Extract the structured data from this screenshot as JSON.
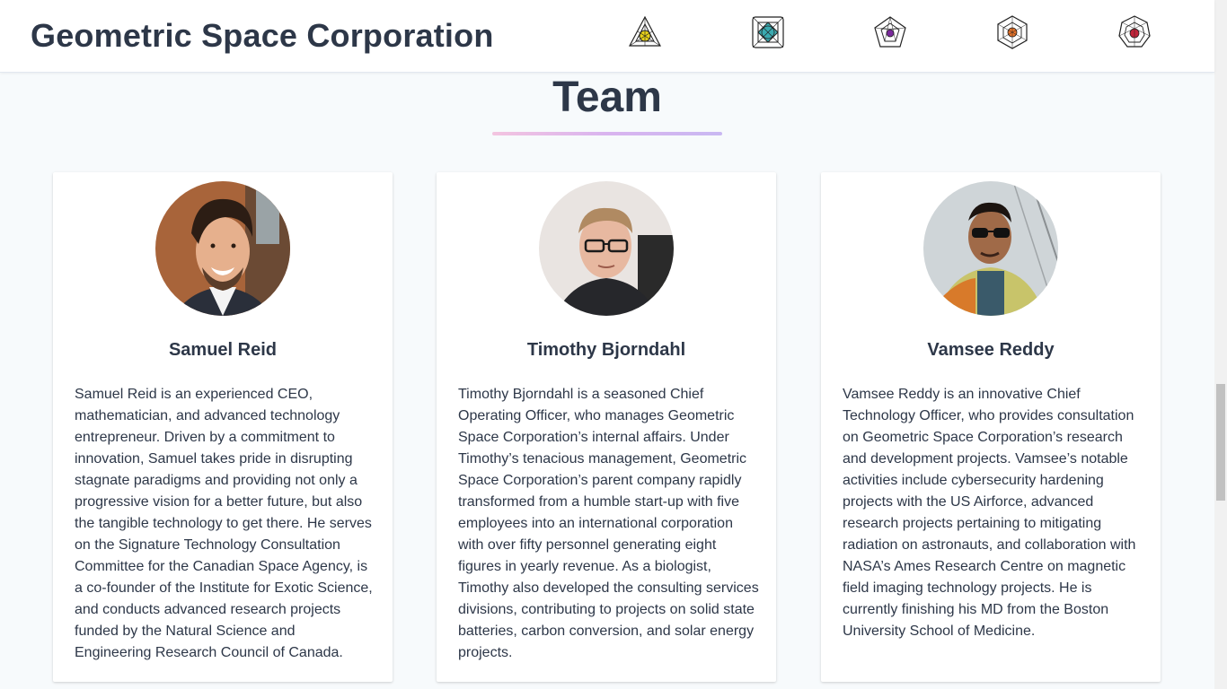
{
  "header": {
    "brand": "Geometric Space Corporation",
    "nav_icons": [
      {
        "name": "triangle-sacred-geometry-icon",
        "accent": "#e8d21a"
      },
      {
        "name": "square-sacred-geometry-icon",
        "accent": "#3aaab0"
      },
      {
        "name": "pentagon-sacred-geometry-icon",
        "accent": "#7a2a9c"
      },
      {
        "name": "hexagon-sacred-geometry-icon",
        "accent": "#e8742a"
      },
      {
        "name": "heptagon-sacred-geometry-icon",
        "accent": "#c0243a"
      }
    ]
  },
  "team": {
    "title": "Team",
    "members": [
      {
        "name": "Samuel Reid",
        "bio": "Samuel Reid is an experienced CEO, mathematician, and advanced technology entrepreneur. Driven by a commitment to innovation, Samuel takes pride in disrupting stagnate paradigms and providing not only a progressive vision for a better future, but also the tangible technology to get there. He serves on the Signature Technology Consultation Committee for the Canadian Space Agency, is a co-founder of the Institute for Exotic Science, and conducts advanced research projects funded by the Natural Science and Engineering Research Council of Canada."
      },
      {
        "name": "Timothy Bjorndahl",
        "bio": "Timothy Bjorndahl is a seasoned Chief Operating Officer, who manages Geometric Space Corporation’s internal affairs. Under Timothy’s tenacious management, Geometric Space Corporation’s parent company rapidly transformed from a humble start-up with five employees into an international corporation with over fifty personnel generating eight figures in yearly revenue. As a biologist, Timothy also developed the consulting services divisions, contributing to projects on solid state batteries, carbon conversion, and solar energy projects."
      },
      {
        "name": "Vamsee Reddy",
        "bio": "Vamsee Reddy is an innovative Chief Technology Officer, who provides consultation on Geometric Space Corporation’s research and development projects. Vamsee’s notable activities include cybersecurity hardening projects with the US Airforce, advanced research projects pertaining to mitigating radiation on astronauts, and collaboration with NASA’s Ames Research Centre on magnetic field imaging technology projects. He is currently finishing his MD from the Boston University School of Medicine."
      }
    ]
  }
}
